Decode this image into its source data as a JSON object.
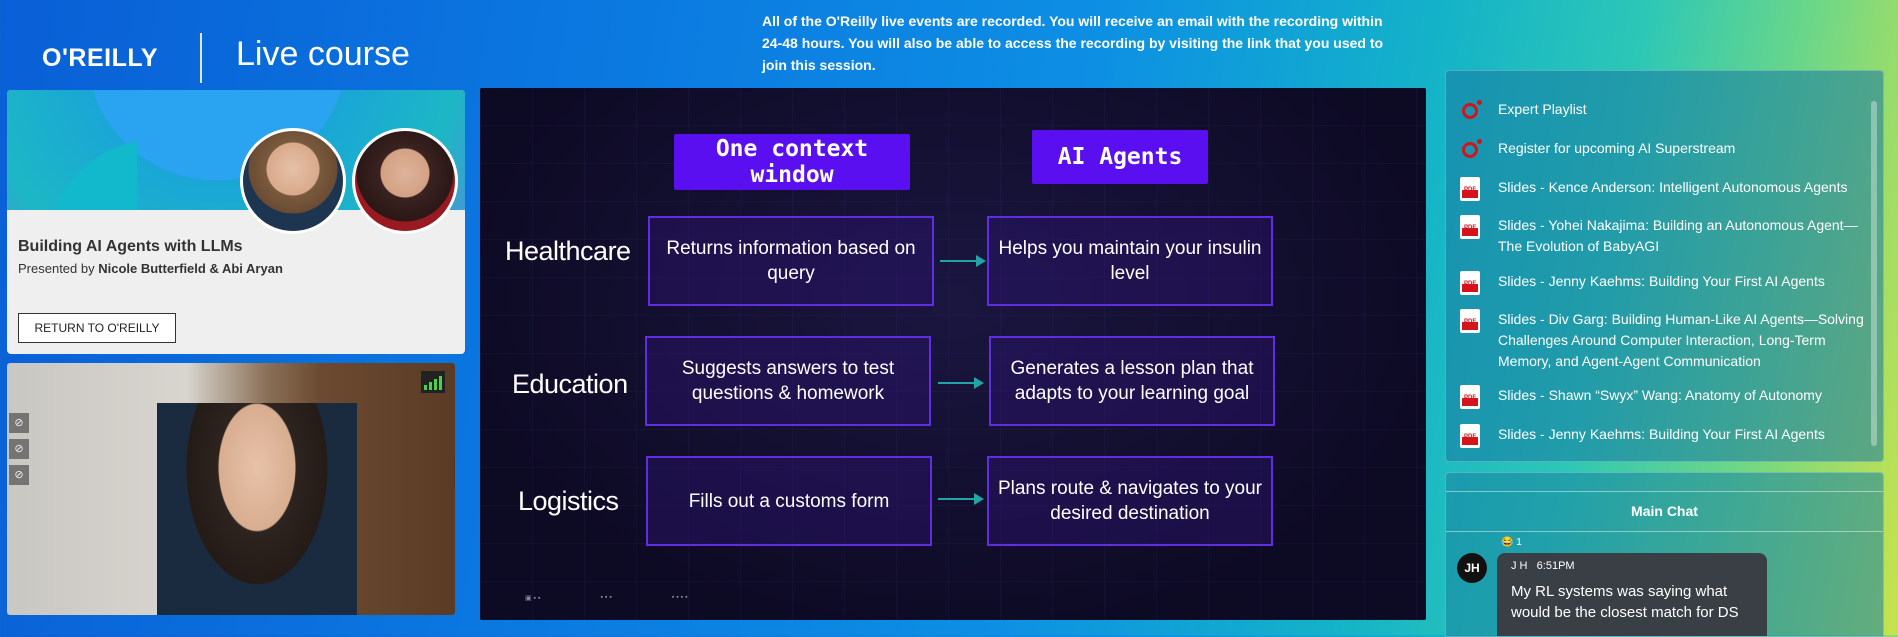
{
  "header": {
    "logo": "O'REILLY",
    "title": "Live course",
    "notice": "All of the O'Reilly live events are recorded. You will receive an email with the recording within 24-48 hours. You will also be able to access the recording by visiting the link that you used to join this session."
  },
  "course": {
    "title": "Building AI Agents with LLMs",
    "presented_prefix": "Presented by ",
    "presenters": "Nicole Butterfield & Abi Aryan",
    "return_button": "RETURN TO O'REILLY"
  },
  "slide": {
    "headers": [
      "One context window",
      "AI Agents"
    ],
    "rows": [
      {
        "label": "Healthcare",
        "left": "Returns information based on query",
        "right": "Helps you maintain your insulin level"
      },
      {
        "label": "Education",
        "left": "Suggests answers to test questions & homework",
        "right": "Generates a lesson plan that adapts to your learning goal"
      },
      {
        "label": "Logistics",
        "left": "Fills out a customs form",
        "right": "Plans route & navigates to your desired destination"
      }
    ]
  },
  "resources": [
    {
      "icon": "oreilly-icon",
      "text": "Expert Playlist"
    },
    {
      "icon": "oreilly-icon",
      "text": "Register for upcoming AI Superstream"
    },
    {
      "icon": "pdf-icon",
      "text": "Slides - Kence Anderson: Intelligent Autonomous Agents"
    },
    {
      "icon": "pdf-icon",
      "text": "Slides - Yohei Nakajima: Building an Autonomous Agent—The Evolution of BabyAGI"
    },
    {
      "icon": "pdf-icon",
      "text": "Slides - Jenny Kaehms: Building Your First AI Agents"
    },
    {
      "icon": "pdf-icon",
      "text": "Slides - Div Garg: Building Human-Like AI Agents—Solving Challenges Around Computer Interaction, Long-Term Memory, and Agent-Agent Communication"
    },
    {
      "icon": "pdf-icon",
      "text": "Slides - Shawn “Swyx” Wang: Anatomy of Autonomy"
    },
    {
      "icon": "pdf-icon",
      "text": "Slides - Jenny Kaehms: Building Your First AI Agents"
    }
  ],
  "chat": {
    "title": "Main Chat",
    "reaction": "😂 1",
    "message": {
      "initials": "JH",
      "author": "J H",
      "time": "6:51PM",
      "text": "My RL systems was saying what would be the closest match for DS"
    }
  },
  "colors": {
    "accent": "#5a0ff0",
    "oreilly_red": "#d3141b",
    "arrow": "#22a3a6"
  }
}
